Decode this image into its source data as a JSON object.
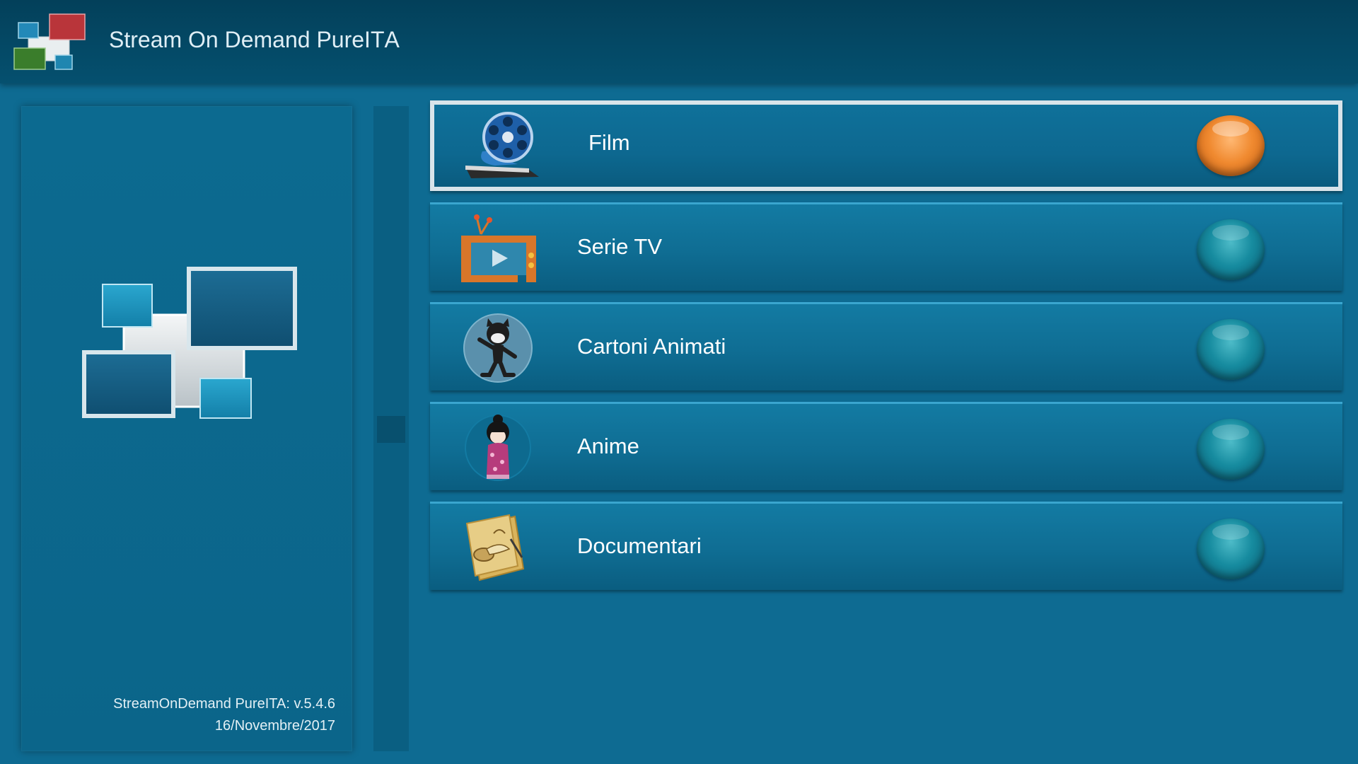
{
  "header": {
    "title": "Stream On Demand PureITА"
  },
  "info_panel": {
    "version_line": "StreamOnDemand PureITA: v.5.4.6",
    "date_line": "16/Novembre/2017"
  },
  "menu": {
    "items": [
      {
        "label": "Film",
        "icon": "film-reel-icon",
        "selected": true
      },
      {
        "label": "Serie TV",
        "icon": "tv-icon",
        "selected": false
      },
      {
        "label": "Cartoni Animati",
        "icon": "cartoon-cat-icon",
        "selected": false
      },
      {
        "label": "Anime",
        "icon": "kokeshi-doll-icon",
        "selected": false
      },
      {
        "label": "Documentari",
        "icon": "documents-scroll-icon",
        "selected": false
      }
    ]
  },
  "colors": {
    "background": "#0e6b92",
    "header": "#04475f",
    "selected_orb": "#f08a30",
    "orb": "#168b9f",
    "selected_border": "#d8e4ea"
  }
}
